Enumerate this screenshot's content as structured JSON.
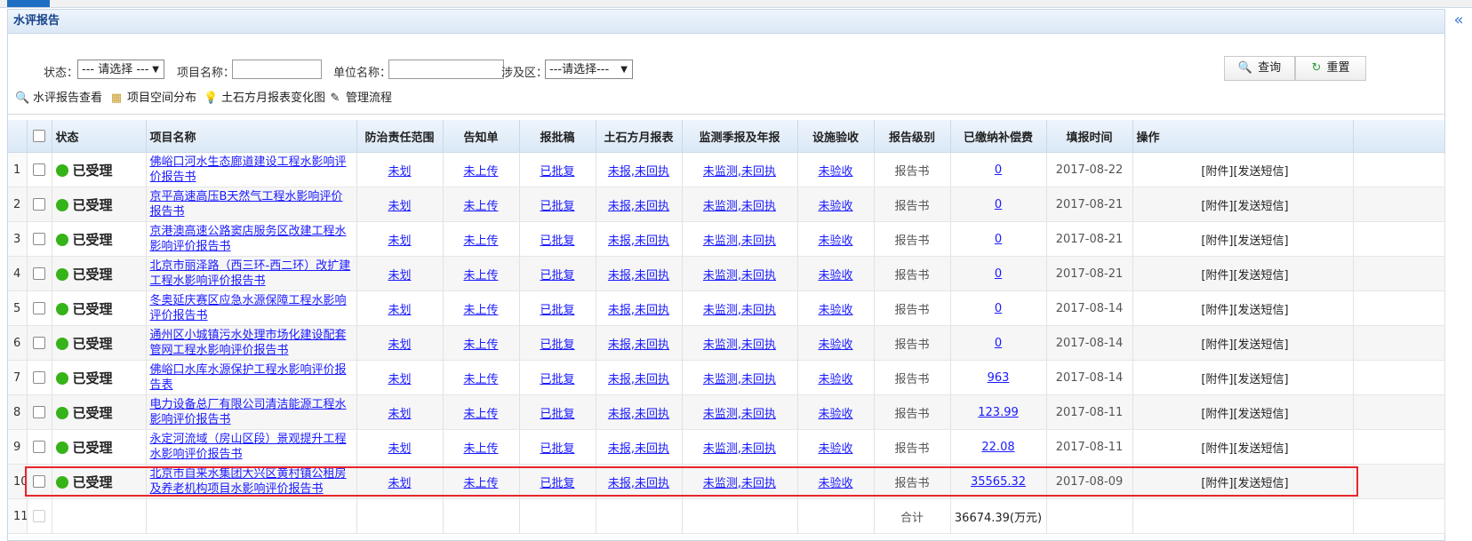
{
  "panel": {
    "title": "水评报告",
    "collapse_icon": "double-left-chevron"
  },
  "search": {
    "status_label": "状态：",
    "status_value": "--- 请选择 ---",
    "project_label": "项目名称：",
    "project_value": "",
    "unit_label": "单位名称：",
    "unit_value": "",
    "district_label": "涉及区：",
    "district_value": "---请选择---",
    "query_label": "查询",
    "reset_label": "重置"
  },
  "toolbar": {
    "view": "水评报告查看",
    "spatial": "项目空间分布",
    "earthwork": "土石方月报表变化图",
    "flow": "管理流程"
  },
  "columns": [
    "状态",
    "项目名称",
    "防治责任范围",
    "告知单",
    "报批稿",
    "土石方月报表",
    "监测季报及年报",
    "设施验收",
    "报告级别",
    "已缴纳补偿费",
    "填报时间",
    "操作"
  ],
  "rows": [
    {
      "no": "1",
      "status": "已受理",
      "name": "佛峪口河水生态廊道建设工程水影响评价报告书",
      "scope": "未划",
      "notice": "未上传",
      "approval": "已批复",
      "earth": "未报,未回执",
      "monitor": "未监测,未回执",
      "accept": "未验收",
      "level": "报告书",
      "fee": "0",
      "date": "2017-08-22",
      "ops": "[附件][发送短信]"
    },
    {
      "no": "2",
      "status": "已受理",
      "name": "京平高速高压B天然气工程水影响评价报告书",
      "scope": "未划",
      "notice": "未上传",
      "approval": "已批复",
      "earth": "未报,未回执",
      "monitor": "未监测,未回执",
      "accept": "未验收",
      "level": "报告书",
      "fee": "0",
      "date": "2017-08-21",
      "ops": "[附件][发送短信]"
    },
    {
      "no": "3",
      "status": "已受理",
      "name": "京港澳高速公路窦店服务区改建工程水影响评价报告书",
      "scope": "未划",
      "notice": "未上传",
      "approval": "已批复",
      "earth": "未报,未回执",
      "monitor": "未监测,未回执",
      "accept": "未验收",
      "level": "报告书",
      "fee": "0",
      "date": "2017-08-21",
      "ops": "[附件][发送短信]"
    },
    {
      "no": "4",
      "status": "已受理",
      "name": "北京市丽泽路（西三环-西二环）改扩建工程水影响评价报告书",
      "scope": "未划",
      "notice": "未上传",
      "approval": "已批复",
      "earth": "未报,未回执",
      "monitor": "未监测,未回执",
      "accept": "未验收",
      "level": "报告书",
      "fee": "0",
      "date": "2017-08-21",
      "ops": "[附件][发送短信]"
    },
    {
      "no": "5",
      "status": "已受理",
      "name": "冬奥延庆赛区应急水源保障工程水影响评价报告书",
      "scope": "未划",
      "notice": "未上传",
      "approval": "已批复",
      "earth": "未报,未回执",
      "monitor": "未监测,未回执",
      "accept": "未验收",
      "level": "报告书",
      "fee": "0",
      "date": "2017-08-14",
      "ops": "[附件][发送短信]"
    },
    {
      "no": "6",
      "status": "已受理",
      "name": "通州区小城镇污水处理市场化建设配套管网工程水影响评价报告书",
      "scope": "未划",
      "notice": "未上传",
      "approval": "已批复",
      "earth": "未报,未回执",
      "monitor": "未监测,未回执",
      "accept": "未验收",
      "level": "报告书",
      "fee": "0",
      "date": "2017-08-14",
      "ops": "[附件][发送短信]"
    },
    {
      "no": "7",
      "status": "已受理",
      "name": "佛峪口水库水源保护工程水影响评价报告表",
      "scope": "未划",
      "notice": "未上传",
      "approval": "已批复",
      "earth": "未报,未回执",
      "monitor": "未监测,未回执",
      "accept": "未验收",
      "level": "报告书",
      "fee": "963",
      "date": "2017-08-14",
      "ops": "[附件][发送短信]"
    },
    {
      "no": "8",
      "status": "已受理",
      "name": "电力设备总厂有限公司清洁能源工程水影响评价报告书",
      "scope": "未划",
      "notice": "未上传",
      "approval": "已批复",
      "earth": "未报,未回执",
      "monitor": "未监测,未回执",
      "accept": "未验收",
      "level": "报告书",
      "fee": "123.99",
      "date": "2017-08-11",
      "ops": "[附件][发送短信]"
    },
    {
      "no": "9",
      "status": "已受理",
      "name": "永定河流域（房山区段）景观提升工程水影响评价报告书",
      "scope": "未划",
      "notice": "未上传",
      "approval": "已批复",
      "earth": "未报,未回执",
      "monitor": "未监测,未回执",
      "accept": "未验收",
      "level": "报告书",
      "fee": "22.08",
      "date": "2017-08-11",
      "ops": "[附件][发送短信]"
    },
    {
      "no": "10",
      "status": "已受理",
      "name": "北京市自来水集团大兴区黄村镇公租房及养老机构项目水影响评价报告书",
      "scope": "未划",
      "notice": "未上传",
      "approval": "已批复",
      "earth": "未报,未回执",
      "monitor": "未监测,未回执",
      "accept": "未验收",
      "level": "报告书",
      "fee": "35565.32",
      "date": "2017-08-09",
      "ops": "[附件][发送短信]"
    }
  ],
  "total": {
    "no": "11",
    "label": "合计",
    "value": "36674.39(万元)"
  },
  "colors": {
    "accent": "#1e6fc4",
    "status_dot": "#35b318",
    "highlight": "#e8262b"
  }
}
